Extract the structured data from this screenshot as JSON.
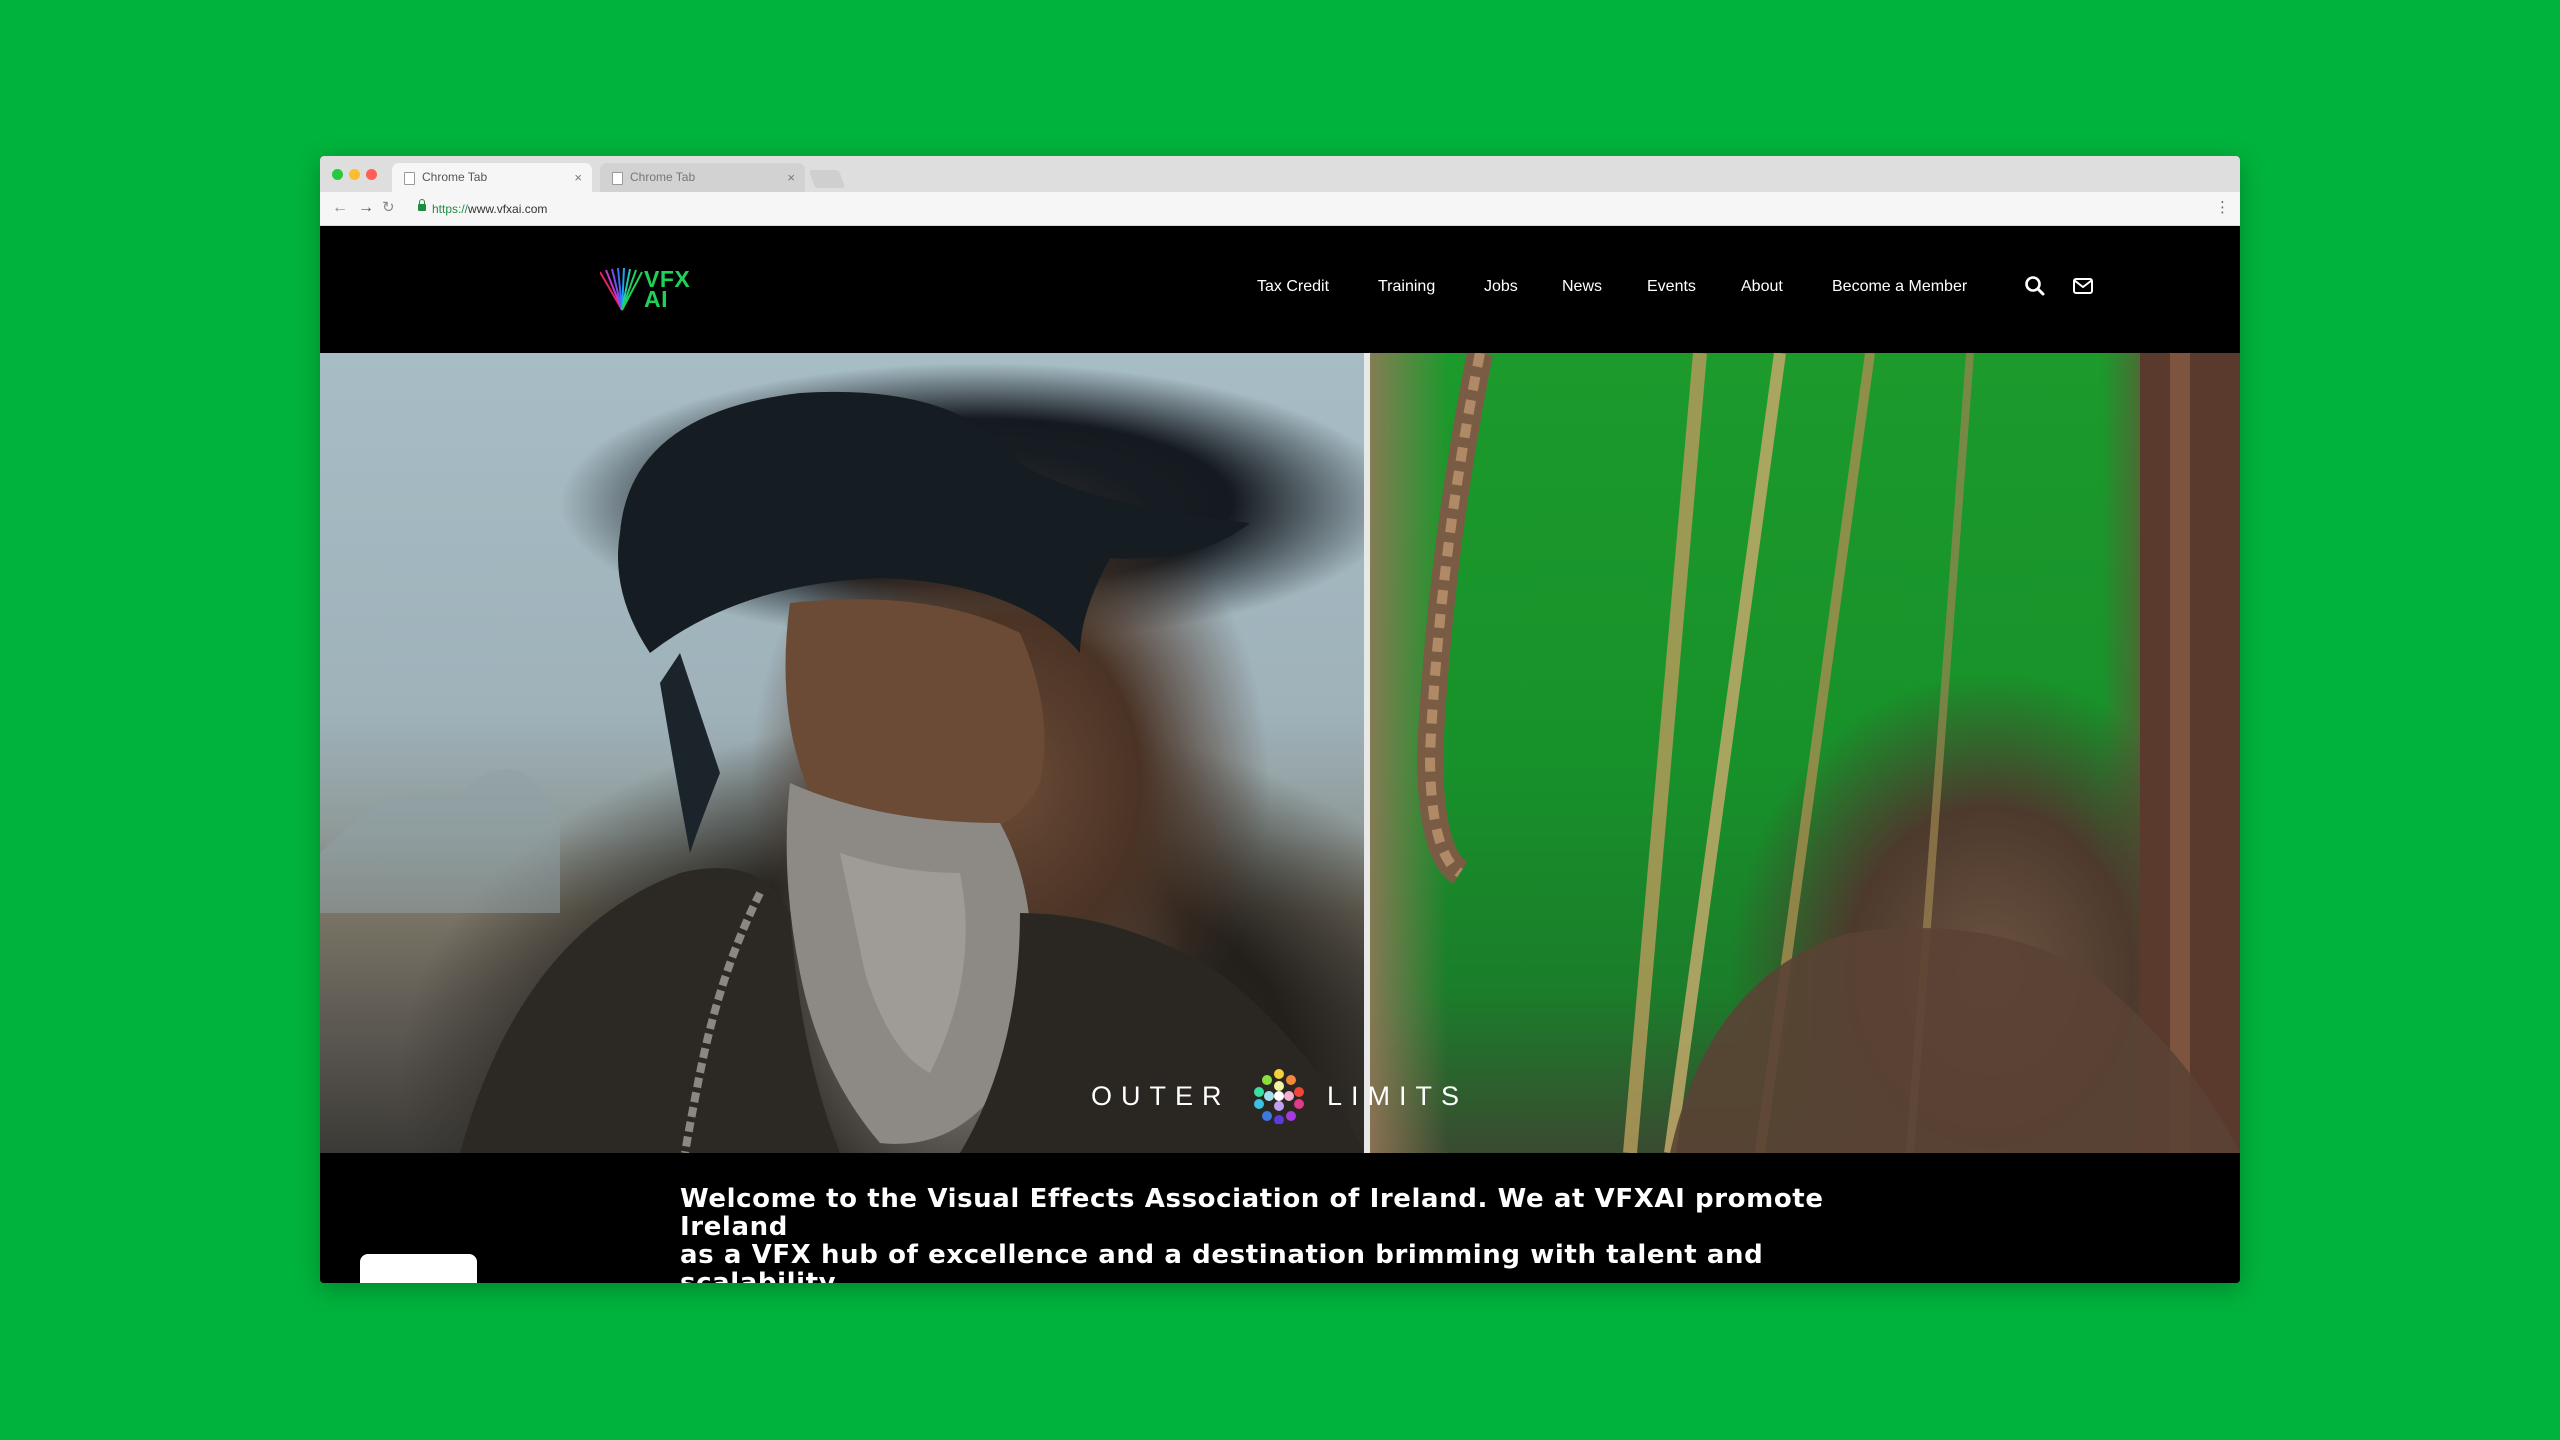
{
  "browser": {
    "tabs": [
      {
        "label": "Chrome Tab",
        "close": "×"
      },
      {
        "label": "Chrome Tab",
        "close": "×"
      }
    ],
    "nav": {
      "back": "←",
      "forward": "→",
      "reload": "↻",
      "menu": "⋮"
    },
    "url": {
      "scheme": "https://",
      "rest": "www.vfxai.com"
    }
  },
  "site": {
    "logo": {
      "line1": "VFX",
      "line2": "AI"
    },
    "nav": [
      "Tax Credit",
      "Training",
      "Jobs",
      "News",
      "Events",
      "About",
      "Become a Member"
    ],
    "icons": [
      "search-icon",
      "mail-icon"
    ],
    "accent": "#1fd15a"
  },
  "hero": {
    "caption": {
      "left": "OUTER",
      "right": "LIMITS"
    }
  },
  "intro": {
    "line1": "Welcome to the Visual Effects Association of Ireland. We at VFXAI promote Ireland",
    "line2": "as a VFX hub of excellence and a destination brimming with talent and scalability."
  },
  "colors": {
    "background": "#00b33c",
    "header": "#000000",
    "text": "#ffffff"
  }
}
